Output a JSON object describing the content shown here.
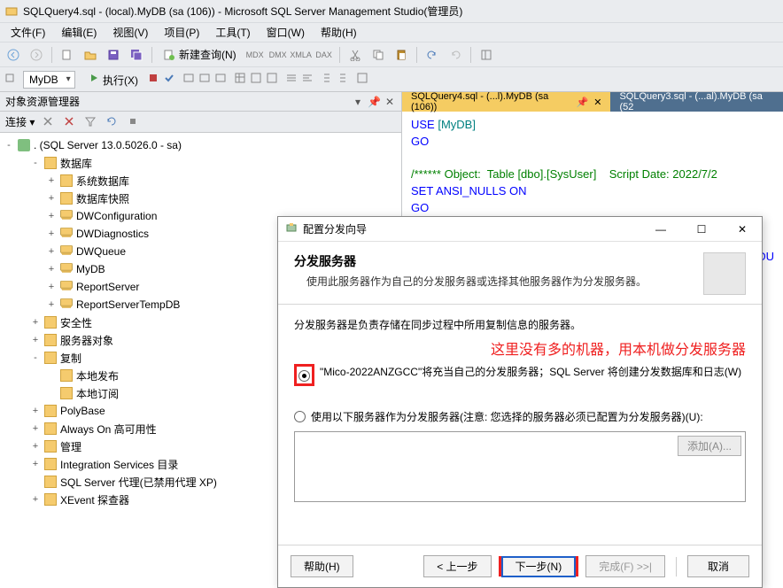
{
  "title": "SQLQuery4.sql - (local).MyDB (sa (106)) - Microsoft SQL Server Management Studio(管理员)",
  "menu": [
    "文件(F)",
    "编辑(E)",
    "视图(V)",
    "项目(P)",
    "工具(T)",
    "窗口(W)",
    "帮助(H)"
  ],
  "toolbar": {
    "new_query": "新建查询(N)",
    "execute": "执行(X)"
  },
  "db_combo": "MyDB",
  "panel": {
    "title": "对象资源管理器",
    "connect": "连接 ▾"
  },
  "tree": {
    "root": ". (SQL Server 13.0.5026.0 - sa)",
    "nodes": [
      {
        "depth": 1,
        "tw": "-",
        "ic": "folder",
        "label": "数据库"
      },
      {
        "depth": 2,
        "tw": "+",
        "ic": "folder",
        "label": "系统数据库"
      },
      {
        "depth": 2,
        "tw": "+",
        "ic": "folder",
        "label": "数据库快照"
      },
      {
        "depth": 2,
        "tw": "+",
        "ic": "db",
        "label": "DWConfiguration"
      },
      {
        "depth": 2,
        "tw": "+",
        "ic": "db",
        "label": "DWDiagnostics"
      },
      {
        "depth": 2,
        "tw": "+",
        "ic": "db",
        "label": "DWQueue"
      },
      {
        "depth": 2,
        "tw": "+",
        "ic": "db",
        "label": "MyDB"
      },
      {
        "depth": 2,
        "tw": "+",
        "ic": "db",
        "label": "ReportServer"
      },
      {
        "depth": 2,
        "tw": "+",
        "ic": "db",
        "label": "ReportServerTempDB"
      },
      {
        "depth": 1,
        "tw": "+",
        "ic": "folder",
        "label": "安全性"
      },
      {
        "depth": 1,
        "tw": "+",
        "ic": "folder",
        "label": "服务器对象"
      },
      {
        "depth": 1,
        "tw": "-",
        "ic": "folder",
        "label": "复制"
      },
      {
        "depth": 2,
        "tw": "",
        "ic": "folder",
        "label": "本地发布"
      },
      {
        "depth": 2,
        "tw": "",
        "ic": "folder",
        "label": "本地订阅"
      },
      {
        "depth": 1,
        "tw": "+",
        "ic": "folder",
        "label": "PolyBase"
      },
      {
        "depth": 1,
        "tw": "+",
        "ic": "folder",
        "label": "Always On 高可用性"
      },
      {
        "depth": 1,
        "tw": "+",
        "ic": "folder",
        "label": "管理"
      },
      {
        "depth": 1,
        "tw": "+",
        "ic": "folder",
        "label": "Integration Services 目录"
      },
      {
        "depth": 1,
        "tw": "",
        "ic": "agent",
        "label": "SQL Server 代理(已禁用代理 XP)"
      },
      {
        "depth": 1,
        "tw": "+",
        "ic": "xevent",
        "label": "XEvent 探查器"
      }
    ]
  },
  "tabs": [
    {
      "label": "SQLQuery4.sql - (...l).MyDB (sa (106))",
      "active": true
    },
    {
      "label": "SQLQuery3.sql - (...al).MyDB (sa (52",
      "active": false
    }
  ],
  "sql": {
    "line1a": "USE ",
    "line1b": "[MyDB]",
    "line2": "GO",
    "line3": "/****** Object:  Table [dbo].[SysUser]    Script Date: 2022/7/2",
    "line4a": "SET ",
    "line4b": "ANSI_NULLS ",
    "line4c": "ON",
    "line5": "GO",
    "line6": "DU"
  },
  "wizard": {
    "window_title": "配置分发向导",
    "heading": "分发服务器",
    "sub": "使用此服务器作为自己的分发服务器或选择其他服务器作为分发服务器。",
    "desc": "分发服务器是负责存储在同步过程中所用复制信息的服务器。",
    "note": "这里没有多的机器，用本机做分发服务器",
    "opt1": "\"Mico-2022ANZGCC\"将充当自己的分发服务器；SQL Server 将创建分发数据库和日志(W)",
    "opt2": "使用以下服务器作为分发服务器(注意: 您选择的服务器必须已配置为分发服务器)(U):",
    "add": "添加(A)...",
    "help": "帮助(H)",
    "back": "< 上一步",
    "next": "下一步(N)",
    "finish": "完成(F) >>|",
    "cancel": "取消"
  }
}
